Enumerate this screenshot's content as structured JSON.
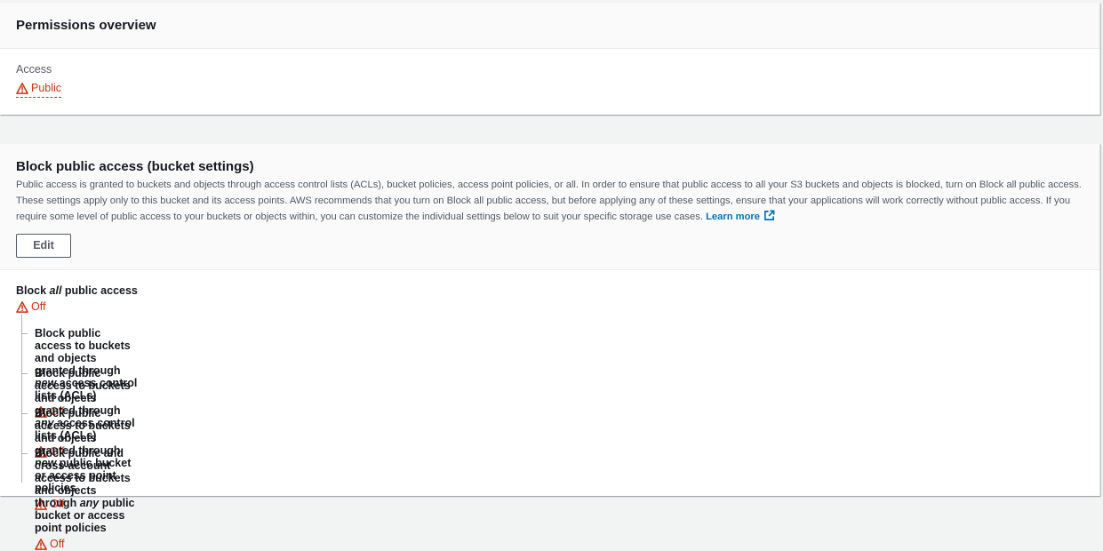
{
  "permissions_overview": {
    "title": "Permissions overview",
    "access_label": "Access",
    "access_value": "Public"
  },
  "block_public_access": {
    "title": "Block public access (bucket settings)",
    "description": "Public access is granted to buckets and objects through access control lists (ACLs), bucket policies, access point policies, or all. In order to ensure that public access to all your S3 buckets and objects is blocked, turn on Block all public access. These settings apply only to this bucket and its access points. AWS recommends that you turn on Block all public access, but before applying any of these settings, ensure that your applications will work correctly without public access. If you require some level of public access to your buckets or objects within, you can customize the individual settings below to suit your specific storage use cases.",
    "learn_more": "Learn more",
    "edit_label": "Edit",
    "block_all": {
      "prefix": "Block ",
      "emphasis": "all",
      "suffix": " public access",
      "status": "Off"
    },
    "settings": [
      {
        "prefix": "Block public access to buckets and objects granted through ",
        "emphasis": "new",
        "suffix": " access control lists (ACLs)",
        "status": "Off"
      },
      {
        "prefix": "Block public access to buckets and objects granted through ",
        "emphasis": "any",
        "suffix": " access control lists (ACLs)",
        "status": "Off"
      },
      {
        "prefix": "Block public access to buckets and objects granted through ",
        "emphasis": "new",
        "suffix": " public bucket or access point policies",
        "status": "Off"
      },
      {
        "prefix": "Block public and cross-account access to buckets and objects through ",
        "emphasis": "any",
        "suffix": " public bucket or access point policies",
        "status": "Off"
      }
    ]
  },
  "colors": {
    "warning": "#d13212",
    "link": "#0073bb",
    "text": "#16191f",
    "muted": "#545b64"
  },
  "icons": {
    "warning": "warning-triangle-icon",
    "external": "external-link-icon"
  }
}
